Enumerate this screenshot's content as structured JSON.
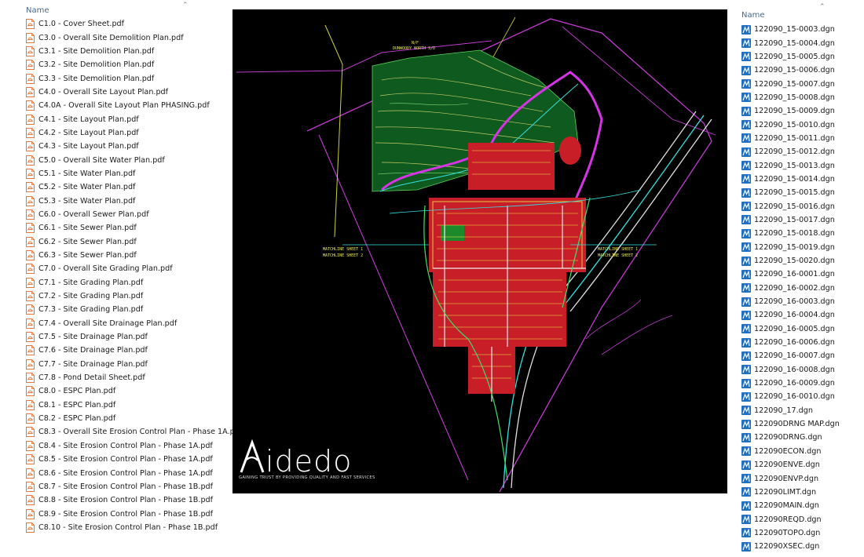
{
  "left_pane": {
    "column_header": "Name",
    "files": [
      "C1.0 - Cover Sheet.pdf",
      "C3.0 - Overall Site Demolition Plan.pdf",
      "C3.1 - Site Demolition Plan.pdf",
      "C3.2 - Site Demolition Plan.pdf",
      "C3.3 - Site Demolition Plan.pdf",
      "C4.0 - Overall Site Layout Plan.pdf",
      "C4.0A - Overall Site Layout Plan PHASING.pdf",
      "C4.1 - Site Layout Plan.pdf",
      "C4.2 - Site Layout Plan.pdf",
      "C4.3 - Site Layout Plan.pdf",
      "C5.0 - Overall Site Water Plan.pdf",
      "C5.1 - Site Water Plan.pdf",
      "C5.2 - Site Water Plan.pdf",
      "C5.3 - Site Water Plan.pdf",
      "C6.0 - Overall Sewer Plan.pdf",
      "C6.1 - Site Sewer Plan.pdf",
      "C6.2 - Site Sewer Plan.pdf",
      "C6.3 - Site Sewer Plan.pdf",
      "C7.0 - Overall Site Grading Plan.pdf",
      "C7.1 - Site Grading Plan.pdf",
      "C7.2 - Site Grading Plan.pdf",
      "C7.3 - Site Grading Plan.pdf",
      "C7.4 - Overall Site Drainage Plan.pdf",
      "C7.5 - Site Drainage Plan.pdf",
      "C7.6 - Site Drainage Plan.pdf",
      "C7.7 - Site Drainage Plan.pdf",
      "C7.8 - Pond Detail Sheet.pdf",
      "C8.0 - ESPC Plan.pdf",
      "C8.1 - ESPC Plan.pdf",
      "C8.2 - ESPC Plan.pdf",
      "C8.3 - Overall Site Erosion Control Plan - Phase 1A.pdf",
      "C8.4 - Site Erosion Control Plan - Phase 1A.pdf",
      "C8.5 - Site Erosion Control Plan - Phase 1A.pdf",
      "C8.6 - Site Erosion Control Plan - Phase 1A.pdf",
      "C8.7 - Site Erosion Control Plan - Phase 1B.pdf",
      "C8.8 - Site Erosion Control Plan - Phase 1B.pdf",
      "C8.9 - Site Erosion Control Plan - Phase 1B.pdf",
      "C8.10 - Site Erosion Control Plan - Phase 1B.pdf"
    ]
  },
  "right_pane": {
    "column_header": "Name",
    "files": [
      "122090_15-0003.dgn",
      "122090_15-0004.dgn",
      "122090_15-0005.dgn",
      "122090_15-0006.dgn",
      "122090_15-0007.dgn",
      "122090_15-0008.dgn",
      "122090_15-0009.dgn",
      "122090_15-0010.dgn",
      "122090_15-0011.dgn",
      "122090_15-0012.dgn",
      "122090_15-0013.dgn",
      "122090_15-0014.dgn",
      "122090_15-0015.dgn",
      "122090_15-0016.dgn",
      "122090_15-0017.dgn",
      "122090_15-0018.dgn",
      "122090_15-0019.dgn",
      "122090_15-0020.dgn",
      "122090_16-0001.dgn",
      "122090_16-0002.dgn",
      "122090_16-0003.dgn",
      "122090_16-0004.dgn",
      "122090_16-0005.dgn",
      "122090_16-0006.dgn",
      "122090_16-0007.dgn",
      "122090_16-0008.dgn",
      "122090_16-0009.dgn",
      "122090_16-0010.dgn",
      "122090_17.dgn",
      "122090DRNG MAP.dgn",
      "122090DRNG.dgn",
      "122090ECON.dgn",
      "122090ENVE.dgn",
      "122090ENVP.dgn",
      "122090LIMT.dgn",
      "122090MAIN.dgn",
      "122090REQD.dgn",
      "122090TOPO.dgn",
      "122090XSEC.dgn"
    ]
  },
  "preview": {
    "logo_text": "idedo",
    "logo_tagline": "GAINING TRUST BY PROVIDING QUALITY AND FAST SERVICES",
    "labels": {
      "matchline_left_1": "MATCHLINE SHEET 1",
      "matchline_left_2": "MATCHLINE SHEET 2",
      "matchline_right_1": "MATCHLINE SHEET 1",
      "matchline_right_2": "MATCHLINE SHEET 2",
      "nf_top": "N/F",
      "nf_owner": "DUNWOODY NORTH S/D"
    }
  },
  "colors": {
    "pdf_icon": "#e8753a",
    "dgn_icon": "#1f6fc2",
    "cad_background": "#000000",
    "cad_green": "#0f5a1e",
    "cad_magenta": "#d633e6",
    "cad_red": "#e0202a",
    "cad_yellow": "#e8e85a",
    "cad_cyan": "#33e0e0"
  },
  "icons": {
    "pdf": "pdf-file-icon",
    "dgn": "microstation-dgn-file-icon",
    "sort": "chevron-up-icon"
  }
}
